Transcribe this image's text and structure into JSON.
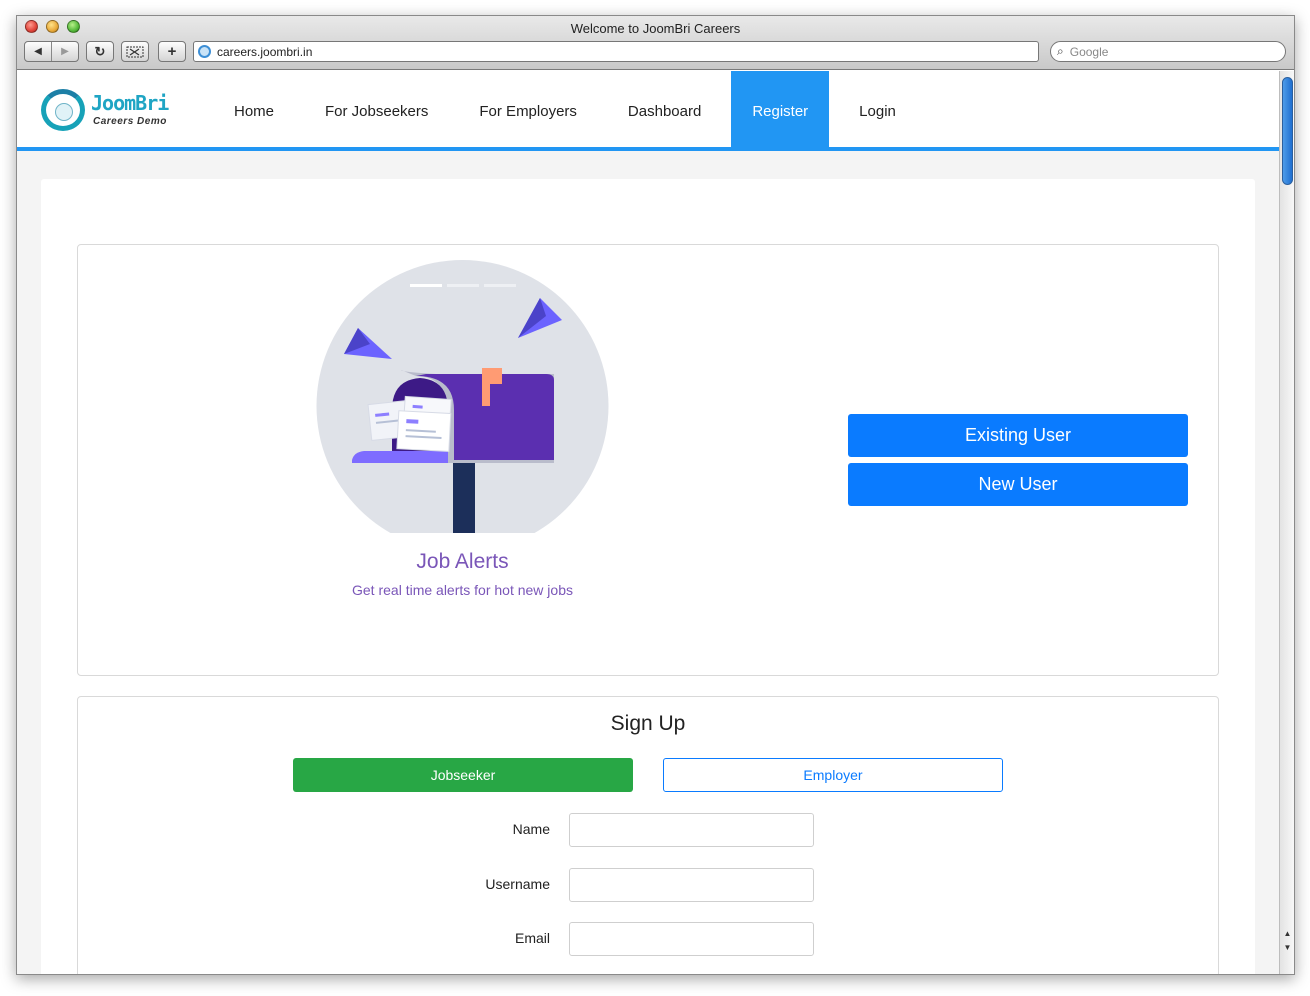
{
  "browser": {
    "title": "Welcome to JoomBri Careers",
    "url": "careers.joombri.in",
    "search_placeholder": "Google"
  },
  "site": {
    "logo_name": "JoomBri",
    "logo_tagline": "Careers Demo",
    "menu": [
      "Home",
      "For Jobseekers",
      "For Employers",
      "Dashboard",
      "Register",
      "Login"
    ],
    "active_menu": "Register",
    "accent_color": "#2196f3"
  },
  "hero": {
    "title": "Job Alerts",
    "subtitle": "Get real time alerts for hot new jobs"
  },
  "auth": {
    "existing_user": "Existing User",
    "new_user": "New User"
  },
  "signup": {
    "title": "Sign Up",
    "jobseeker": "Jobseeker",
    "employer": "Employer",
    "fields": [
      {
        "label": "Name",
        "value": ""
      },
      {
        "label": "Username",
        "value": ""
      },
      {
        "label": "Email",
        "value": ""
      }
    ]
  }
}
